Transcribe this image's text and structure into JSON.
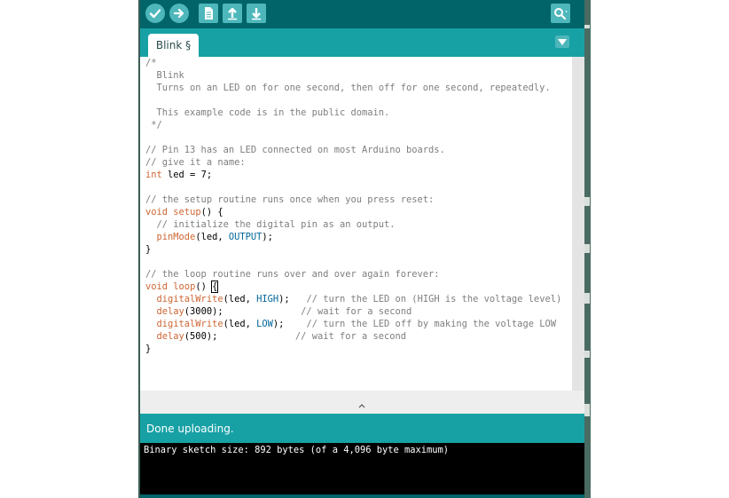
{
  "toolbar": {
    "buttons": [
      {
        "name": "verify",
        "icon": "check-icon"
      },
      {
        "name": "upload",
        "icon": "arrow-right-icon"
      },
      {
        "name": "new",
        "icon": "new-file-icon"
      },
      {
        "name": "open",
        "icon": "arrow-up-icon"
      },
      {
        "name": "save",
        "icon": "arrow-down-icon"
      },
      {
        "name": "serial-monitor",
        "icon": "magnifier-icon"
      }
    ]
  },
  "tab": {
    "label": "Blink §"
  },
  "code_lines": [
    [
      {
        "t": "/*",
        "c": "com"
      }
    ],
    [
      {
        "t": "  Blink",
        "c": "com"
      }
    ],
    [
      {
        "t": "  Turns on an LED on for one second, then off for one second, repeatedly.",
        "c": "com"
      }
    ],
    [
      {
        "t": "",
        "c": ""
      }
    ],
    [
      {
        "t": "  This example code is in the public domain.",
        "c": "com"
      }
    ],
    [
      {
        "t": " */",
        "c": "com"
      }
    ],
    [
      {
        "t": "",
        "c": ""
      }
    ],
    [
      {
        "t": "// Pin 13 has an LED connected on most Arduino boards.",
        "c": "com"
      }
    ],
    [
      {
        "t": "// give it a name:",
        "c": "com"
      }
    ],
    [
      {
        "t": "int",
        "c": "type"
      },
      {
        "t": " led = 7;",
        "c": ""
      }
    ],
    [
      {
        "t": "",
        "c": ""
      }
    ],
    [
      {
        "t": "// the setup routine runs once when you press reset:",
        "c": "com"
      }
    ],
    [
      {
        "t": "void",
        "c": "type"
      },
      {
        "t": " ",
        "c": ""
      },
      {
        "t": "setup",
        "c": "fn"
      },
      {
        "t": "() {",
        "c": ""
      }
    ],
    [
      {
        "t": "  // initialize the digital pin as an output.",
        "c": "com"
      }
    ],
    [
      {
        "t": "  ",
        "c": ""
      },
      {
        "t": "pinMode",
        "c": "fn"
      },
      {
        "t": "(led, ",
        "c": ""
      },
      {
        "t": "OUTPUT",
        "c": "const"
      },
      {
        "t": ");",
        "c": ""
      }
    ],
    [
      {
        "t": "}",
        "c": ""
      }
    ],
    [
      {
        "t": "",
        "c": ""
      }
    ],
    [
      {
        "t": "// the loop routine runs over and over again forever:",
        "c": "com"
      }
    ],
    [
      {
        "t": "void",
        "c": "type"
      },
      {
        "t": " ",
        "c": ""
      },
      {
        "t": "loop",
        "c": "fn"
      },
      {
        "t": "() ",
        "c": ""
      },
      {
        "t": "{",
        "c": "cursor"
      }
    ],
    [
      {
        "t": "  ",
        "c": ""
      },
      {
        "t": "digitalWrite",
        "c": "fn"
      },
      {
        "t": "(led, ",
        "c": ""
      },
      {
        "t": "HIGH",
        "c": "const"
      },
      {
        "t": ");   ",
        "c": ""
      },
      {
        "t": "// turn the LED on (HIGH is the voltage level)",
        "c": "com"
      }
    ],
    [
      {
        "t": "  ",
        "c": ""
      },
      {
        "t": "delay",
        "c": "fn"
      },
      {
        "t": "(3000);              ",
        "c": ""
      },
      {
        "t": "// wait for a second",
        "c": "com"
      }
    ],
    [
      {
        "t": "  ",
        "c": ""
      },
      {
        "t": "digitalWrite",
        "c": "fn"
      },
      {
        "t": "(led, ",
        "c": ""
      },
      {
        "t": "LOW",
        "c": "const"
      },
      {
        "t": ");    ",
        "c": ""
      },
      {
        "t": "// turn the LED off by making the voltage LOW",
        "c": "com"
      }
    ],
    [
      {
        "t": "  ",
        "c": ""
      },
      {
        "t": "delay",
        "c": "fn"
      },
      {
        "t": "(500);              ",
        "c": ""
      },
      {
        "t": "// wait for a second",
        "c": "com"
      }
    ],
    [
      {
        "t": "}",
        "c": ""
      }
    ]
  ],
  "status": {
    "text": "Done uploading."
  },
  "console": {
    "text": "Binary sketch size: 892 bytes (of a 4,096 byte maximum)"
  },
  "colors": {
    "toolbar_bg": "#006468",
    "tabbar_bg": "#17a1a5",
    "button_bg": "#4db7bb",
    "comment": "#7e7e7e",
    "keyword": "#cc6633",
    "constant": "#006699"
  }
}
